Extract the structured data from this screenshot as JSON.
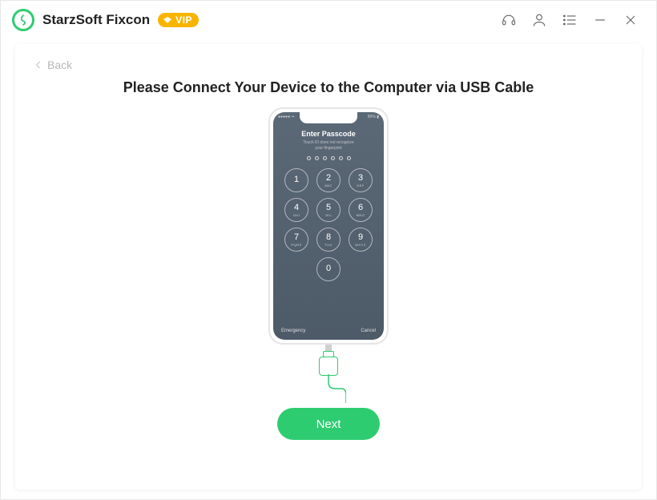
{
  "app": {
    "title": "StarzSoft Fixcon",
    "vip_label": "VIP"
  },
  "nav": {
    "back_label": "Back"
  },
  "main": {
    "heading": "Please Connect Your Device to the Computer via USB Cable",
    "next_label": "Next"
  },
  "phone": {
    "status_left": "●●●●● ⏦",
    "status_right": "80% ▮",
    "title": "Enter Passcode",
    "subtitle_l1": "Touch ID does not recognize",
    "subtitle_l2": "your fingerprint",
    "keys": [
      {
        "n": "1",
        "l": ""
      },
      {
        "n": "2",
        "l": "ABC"
      },
      {
        "n": "3",
        "l": "DEF"
      },
      {
        "n": "4",
        "l": "GHI"
      },
      {
        "n": "5",
        "l": "JKL"
      },
      {
        "n": "6",
        "l": "MNO"
      },
      {
        "n": "7",
        "l": "PQRS"
      },
      {
        "n": "8",
        "l": "TUV"
      },
      {
        "n": "9",
        "l": "WXYZ"
      }
    ],
    "key_zero": {
      "n": "0",
      "l": ""
    },
    "emergency": "Emergency",
    "cancel": "Cancel"
  },
  "colors": {
    "accent": "#2ecc71",
    "vip": "#f7b500"
  }
}
